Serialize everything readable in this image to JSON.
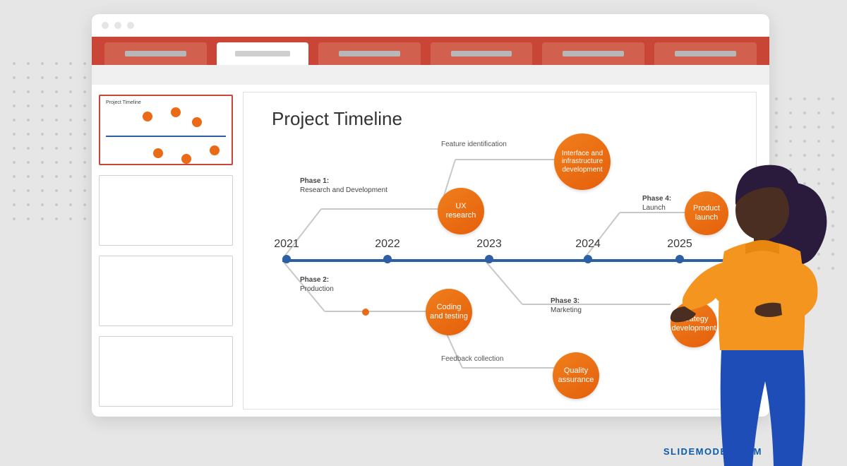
{
  "brand": "SLIDEMODEL.COM",
  "slide": {
    "title": "Project Timeline",
    "years": [
      "2021",
      "2022",
      "2023",
      "2024",
      "2025"
    ],
    "phases": [
      {
        "id": "phase1",
        "name": "Phase 1:",
        "desc": "Research and Development"
      },
      {
        "id": "phase2",
        "name": "Phase 2:",
        "desc": "Production"
      },
      {
        "id": "phase3",
        "name": "Phase 3:",
        "desc": "Marketing"
      },
      {
        "id": "phase4",
        "name": "Phase 4:",
        "desc": "Launch"
      }
    ],
    "branches": {
      "feature_identification": "Feature identification",
      "feedback_collection": "Feedback collection"
    },
    "bubbles": {
      "ux_research": "UX research",
      "interface_infra": "Interface and infrastructure development",
      "coding_testing": "Coding and testing",
      "quality_assurance": "Quality assurance",
      "product_launch": "Product launch",
      "strategy_dev": "Strategy development"
    }
  },
  "thumb_title": "Project Timeline",
  "colors": {
    "ribbon": "#c94535",
    "axis": "#2d5fa5",
    "bubble": "#ea6a17"
  }
}
